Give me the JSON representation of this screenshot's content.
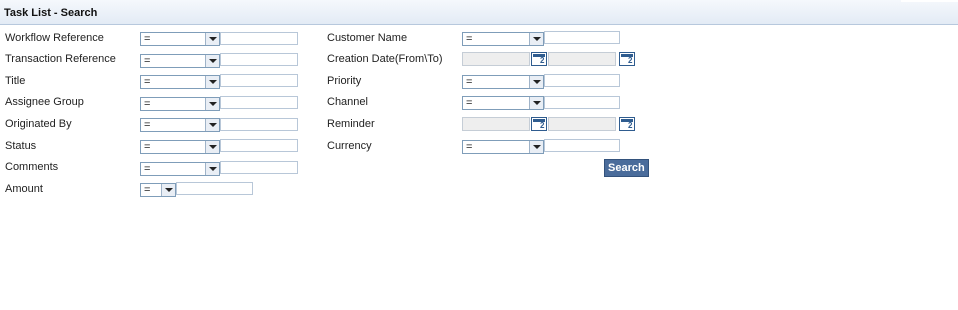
{
  "page_title": "Task List - Search",
  "operator_default": "=",
  "fields": {
    "workflow_reference": {
      "label": "Workflow Reference",
      "operator": "=",
      "value": ""
    },
    "transaction_reference": {
      "label": "Transaction Reference",
      "operator": "=",
      "value": ""
    },
    "title": {
      "label": "Title",
      "operator": "=",
      "value": ""
    },
    "assignee_group": {
      "label": "Assignee Group",
      "operator": "=",
      "value": ""
    },
    "originated_by": {
      "label": "Originated By",
      "operator": "=",
      "value": ""
    },
    "status": {
      "label": "Status",
      "operator": "=",
      "value": ""
    },
    "comments": {
      "label": "Comments",
      "operator": "=",
      "value": ""
    },
    "amount": {
      "label": "Amount",
      "operator": "=",
      "value": ""
    },
    "customer_name": {
      "label": "Customer Name",
      "operator": "=",
      "value": ""
    },
    "creation_date": {
      "label": "Creation Date(From\\To)",
      "from": "",
      "to": ""
    },
    "priority": {
      "label": "Priority",
      "operator": "=",
      "value": ""
    },
    "channel": {
      "label": "Channel",
      "operator": "=",
      "value": ""
    },
    "reminder": {
      "label": "Reminder",
      "from": "",
      "to": ""
    },
    "currency": {
      "label": "Currency",
      "operator": "=",
      "value": ""
    }
  },
  "search_button": "Search",
  "icons": {
    "dropdown": "chevron-down-icon",
    "calendar": "calendar-icon"
  }
}
